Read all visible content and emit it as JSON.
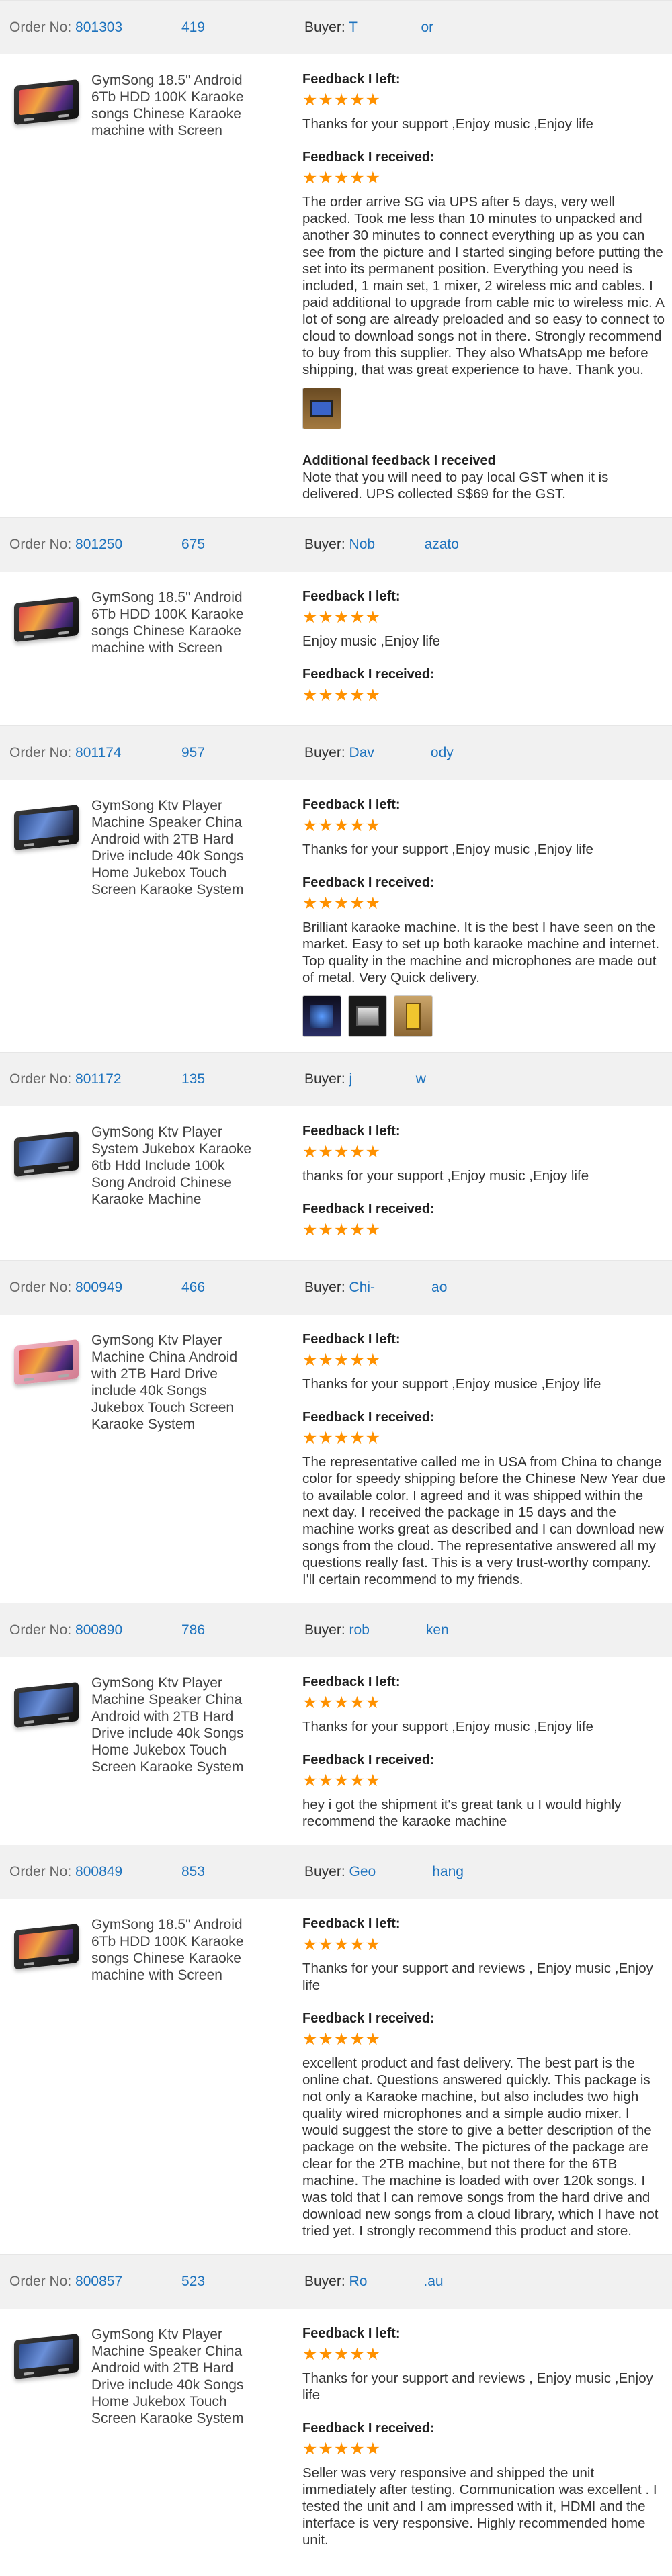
{
  "labels": {
    "order_no": "Order No:",
    "buyer": "Buyer:",
    "feedback_left": "Feedback I left:",
    "feedback_received": "Feedback I received:",
    "additional": "Additional feedback I received",
    "stars": "★★★★★"
  },
  "orders": [
    {
      "order_no": "801303",
      "code": "419",
      "buyer": "T         or",
      "product": "GymSong 18.5\" Android 6Tb HDD 100K Karaoke songs Chinese Karaoke machine with Screen",
      "thumb": "red",
      "left_rating": 5,
      "left": "Thanks for your support ,Enjoy music ,Enjoy life",
      "received_rating": 5,
      "received": "The order arrive SG via UPS after 5 days, very well packed. Took me less than 10 minutes to unpacked and another 30 minutes to connect everything up as you can see from the picture and I started singing before putting the set into its permanent position. Everything you need is included, 1 main set, 1 mixer, 2 wireless mic and cables. I paid additional to upgrade from cable mic to wireless mic. A lot of song are already preloaded and so easy to connect to cloud to download songs not in there. Strongly recommend to buy from this supplier. They also WhatsApp me before shipping, that was great experience to have. Thank you.",
      "photos": [
        "brown"
      ],
      "additional": "Note that you will need to pay local GST when it is delivered. UPS collected S$69 for the GST."
    },
    {
      "order_no": "801250",
      "code": "675",
      "buyer": "Nob       azato",
      "product": "GymSong 18.5\" Android 6Tb HDD 100K Karaoke songs Chinese Karaoke machine with Screen",
      "thumb": "red",
      "left_rating": 5,
      "left": "Enjoy music ,Enjoy life",
      "received_rating": 5,
      "received": "",
      "photos": [],
      "additional": ""
    },
    {
      "order_no": "801174",
      "code": "957",
      "buyer": "Dav        ody",
      "product": "GymSong Ktv Player Machine Speaker China Android with 2TB Hard Drive include 40k Songs Home Jukebox Touch Screen Karaoke System",
      "thumb": "black",
      "left_rating": 5,
      "left": "Thanks for your support ,Enjoy music ,Enjoy life",
      "received_rating": 5,
      "received": "Brilliant karaoke machine. It is the best I have seen on the market. Easy to set up both karaoke machine and internet. Top quality in the machine and microphones are made out of metal. Very Quick delivery.",
      "photos": [
        "dark",
        "black",
        "gold"
      ],
      "additional": ""
    },
    {
      "order_no": "801172",
      "code": "135",
      "buyer": "j         w",
      "product": "GymSong Ktv Player System Jukebox Karaoke 6tb Hdd Include 100k Song Android Chinese Karaoke Machine",
      "thumb": "black",
      "left_rating": 5,
      "left": "thanks for your support ,Enjoy music ,Enjoy life",
      "received_rating": 5,
      "received": "",
      "photos": [],
      "additional": ""
    },
    {
      "order_no": "800949",
      "code": "466",
      "buyer": "Chi-        ao",
      "product": "GymSong Ktv Player Machine China Android with 2TB Hard Drive include 40k Songs Jukebox Touch Screen Karaoke System",
      "thumb": "pink",
      "left_rating": 5,
      "left": "Thanks for your support ,Enjoy musice ,Enjoy life",
      "received_rating": 5,
      "received": "The representative called me in USA from China to change color for speedy shipping before the Chinese New Year due to available color. I agreed and it was shipped within the next day. I received the package in 15 days and the machine works great as described and I can download new songs from the cloud. The representative answered all my questions really fast. This is a very trust-worthy company. I'll certain recommend to my friends.",
      "photos": [],
      "additional": ""
    },
    {
      "order_no": "800890",
      "code": "786",
      "buyer": "rob        ken",
      "product": "GymSong Ktv Player Machine Speaker China Android with 2TB Hard Drive include 40k Songs Home Jukebox Touch Screen Karaoke System",
      "thumb": "black",
      "left_rating": 5,
      "left": "Thanks for your support ,Enjoy music ,Enjoy life",
      "received_rating": 5,
      "received": "hey i got the shipment it's great tank u I would highly recommend the karaoke machine",
      "photos": [],
      "additional": ""
    },
    {
      "order_no": "800849",
      "code": "853",
      "buyer": "Geo        hang",
      "product": "GymSong 18.5\" Android 6Tb HDD 100K Karaoke songs Chinese Karaoke machine with Screen",
      "thumb": "red",
      "left_rating": 5,
      "left": "Thanks for your support and reviews , Enjoy music ,Enjoy life",
      "received_rating": 5,
      "received": "excellent product and fast delivery. The best part is the online chat. Questions answered quickly. This package is not only a Karaoke machine, but also includes two high quality wired microphones and a simple audio mixer. I would suggest the store to give a better description of the package on the website. The pictures of the package are clear for the 2TB machine, but not there for the 6TB machine. The machine is loaded with over 120k songs. I was told that I can remove songs from the hard drive and download new songs from a cloud library, which I have not tried yet. I strongly recommend this product and store.",
      "photos": [],
      "additional": ""
    },
    {
      "order_no": "800857",
      "code": "523",
      "buyer": "Ro        .au",
      "product": "GymSong Ktv Player Machine Speaker China Android with 2TB Hard Drive include 40k Songs Home Jukebox Touch Screen Karaoke System",
      "thumb": "black",
      "left_rating": 5,
      "left": "Thanks for your support and reviews , Enjoy music ,Enjoy life",
      "received_rating": 5,
      "received": "Seller was very responsive and shipped the unit immediately after testing. Communication was excellent . I tested the unit and I am impressed with it, HDMI and the interface is very responsive. Highly recommended home unit.",
      "photos": [],
      "additional": ""
    }
  ]
}
